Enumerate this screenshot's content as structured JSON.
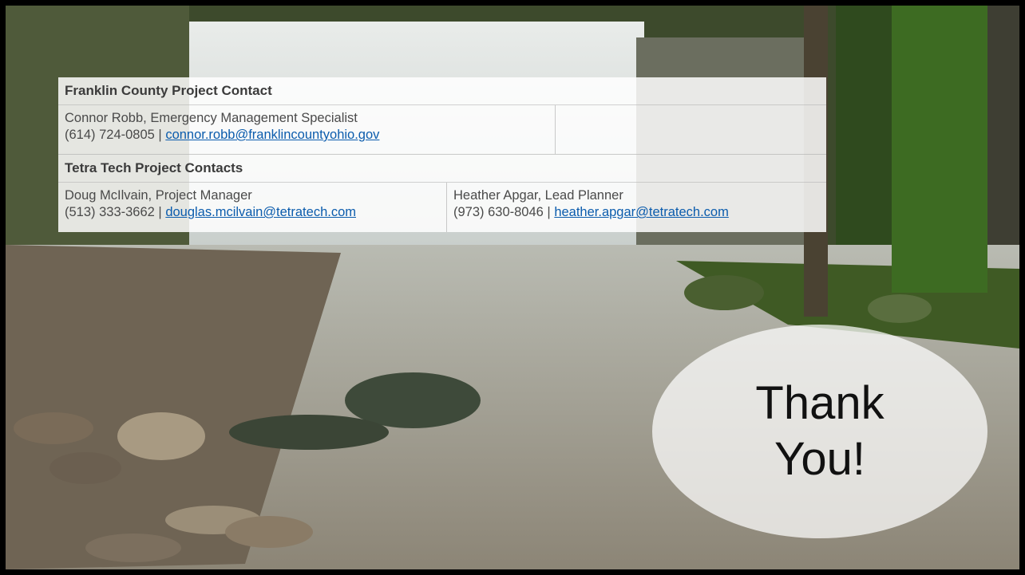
{
  "franklin": {
    "heading": "Franklin County Project Contact",
    "contact": {
      "name_title": "Connor Robb, Emergency Management Specialist",
      "phone": "(614) 724-0805",
      "separator": " | ",
      "email": "connor.robb@franklincountyohio.gov"
    }
  },
  "tetra": {
    "heading": "Tetra Tech Project Contacts",
    "contacts": [
      {
        "name_title": "Doug McIlvain, Project Manager",
        "phone": "(513) 333-3662",
        "separator": " | ",
        "email": "douglas.mcilvain@tetratech.com"
      },
      {
        "name_title": "Heather Apgar, Lead Planner",
        "phone": "(973) 630-8046",
        "separator": " | ",
        "email": "heather.apgar@tetratech.com"
      }
    ]
  },
  "thanks": {
    "line1": "Thank",
    "line2": "You!"
  },
  "colors": {
    "link": "#0b5cad",
    "panel": "#ffffff",
    "text": "#4a4a4a"
  }
}
